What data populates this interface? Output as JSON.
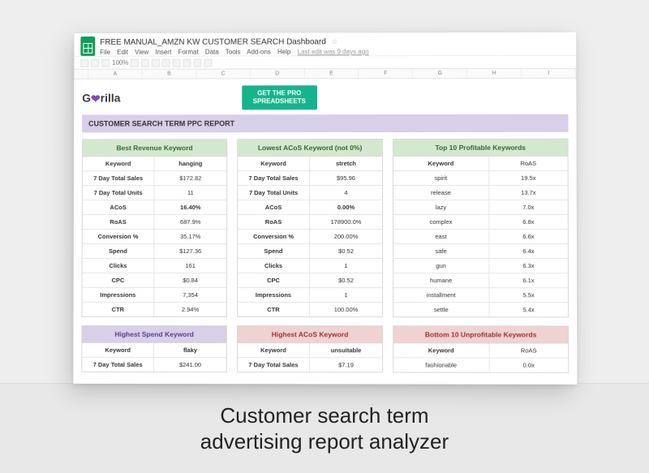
{
  "caption_line1": "Customer search term",
  "caption_line2": "advertising report analyzer",
  "doc": {
    "title": "FREE MANUAL_AMZN KW CUSTOMER SEARCH Dashboard",
    "star": "☆",
    "menus": [
      "File",
      "Edit",
      "View",
      "Insert",
      "Format",
      "Data",
      "Tools",
      "Add-ons",
      "Help"
    ],
    "edit_info": "Last edit was 9 days ago"
  },
  "cols": [
    "A",
    "B",
    "C",
    "D",
    "E",
    "F",
    "G",
    "H",
    "I"
  ],
  "brand": {
    "g": "G",
    "rest": "rilla",
    "heart": "❤"
  },
  "pro_button": "GET THE PRO\nSPREADSHEETS",
  "report_title": "CUSTOMER SEARCH TERM PPC REPORT",
  "panel_best": {
    "title": "Best Revenue Keyword",
    "rows": [
      {
        "k": "Keyword",
        "v": "hanging",
        "accent": true
      },
      {
        "k": "7 Day Total Sales",
        "v": "$172.82"
      },
      {
        "k": "7 Day Total Units",
        "v": "11"
      },
      {
        "k": "ACoS",
        "v": "16.40%",
        "accent": true
      },
      {
        "k": "RoAS",
        "v": "687.9%"
      },
      {
        "k": "Conversion %",
        "v": "35.17%"
      },
      {
        "k": "Spend",
        "v": "$127.36"
      },
      {
        "k": "Clicks",
        "v": "161"
      },
      {
        "k": "CPC",
        "v": "$0.84"
      },
      {
        "k": "Impressions",
        "v": "7,354"
      },
      {
        "k": "CTR",
        "v": "2.94%"
      }
    ]
  },
  "panel_lowest": {
    "title": "Lowest ACoS Keyword (not 0%)",
    "rows": [
      {
        "k": "Keyword",
        "v": "stretch",
        "accent": true
      },
      {
        "k": "7 Day Total Sales",
        "v": "$95.96"
      },
      {
        "k": "7 Day Total Units",
        "v": "4"
      },
      {
        "k": "ACoS",
        "v": "0.00%",
        "accent": true
      },
      {
        "k": "RoAS",
        "v": "178900.0%"
      },
      {
        "k": "Conversion %",
        "v": "200.00%"
      },
      {
        "k": "Spend",
        "v": "$0.52"
      },
      {
        "k": "Clicks",
        "v": "1"
      },
      {
        "k": "CPC",
        "v": "$0.52"
      },
      {
        "k": "Impressions",
        "v": "1"
      },
      {
        "k": "CTR",
        "v": "100.00%"
      }
    ]
  },
  "panel_top10": {
    "title": "Top 10 Profitable Keywords",
    "header": {
      "k": "Keyword",
      "v": "RoAS"
    },
    "rows": [
      {
        "k": "spirit",
        "v": "19.5x"
      },
      {
        "k": "release",
        "v": "13.7x"
      },
      {
        "k": "lazy",
        "v": "7.0x"
      },
      {
        "k": "complex",
        "v": "6.8x"
      },
      {
        "k": "east",
        "v": "6.6x"
      },
      {
        "k": "safe",
        "v": "6.4x"
      },
      {
        "k": "gun",
        "v": "6.3x"
      },
      {
        "k": "humane",
        "v": "6.1x"
      },
      {
        "k": "installment",
        "v": "5.5x"
      },
      {
        "k": "settle",
        "v": "5.4x"
      }
    ]
  },
  "panel_spend": {
    "title": "Highest Spend Keyword",
    "rows": [
      {
        "k": "Keyword",
        "v": "flaky",
        "accent": true
      },
      {
        "k": "7 Day Total Sales",
        "v": "$241.00"
      }
    ]
  },
  "panel_hacos": {
    "title": "Highest ACoS Keyword",
    "rows": [
      {
        "k": "Keyword",
        "v": "unsuitable",
        "accent_red": true
      },
      {
        "k": "7 Day Total Sales",
        "v": "$7.19"
      }
    ]
  },
  "panel_bottom10": {
    "title": "Bottom 10 Unprofitable Keywords",
    "header": {
      "k": "Keyword",
      "v": "RoAS"
    },
    "rows": [
      {
        "k": "fashionable",
        "v": "0.0x"
      }
    ]
  }
}
